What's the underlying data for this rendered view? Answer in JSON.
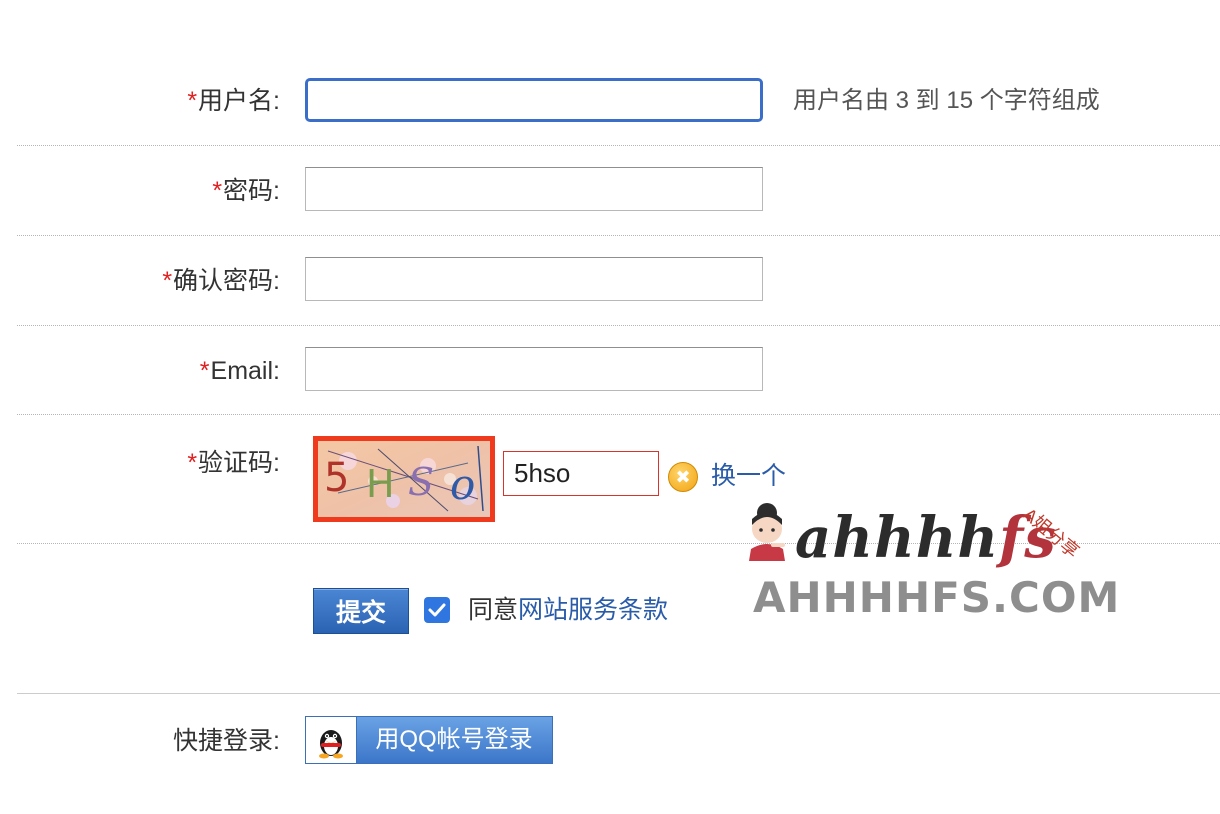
{
  "form": {
    "required_mark": "*",
    "username": {
      "label": "用户名:",
      "value": "",
      "hint": "用户名由 3 到 15 个字符组成"
    },
    "password": {
      "label": "密码:",
      "value": ""
    },
    "confirm_password": {
      "label": "确认密码:",
      "value": ""
    },
    "email": {
      "label": "Email:",
      "value": ""
    },
    "captcha": {
      "label": "验证码:",
      "image_chars": [
        "5",
        "H",
        "S",
        "o"
      ],
      "value": "5hso",
      "refresh_label": "换一个"
    },
    "submit_label": "提交",
    "agree": {
      "checked": true,
      "prefix": "同意",
      "link_text": "网站服务条款"
    },
    "quick_login": {
      "label": "快捷登录:",
      "qq_button_label": "用QQ帐号登录"
    }
  },
  "watermark": {
    "script_text": "ahhhh",
    "script_tail": "fs",
    "tag": "A姐分享",
    "caption": "AHHHHFS.COM"
  },
  "colors": {
    "required": "#e02020",
    "focus_border": "#3a6ec9",
    "link": "#2a5caa",
    "captcha_frame": "#f03a1e"
  }
}
